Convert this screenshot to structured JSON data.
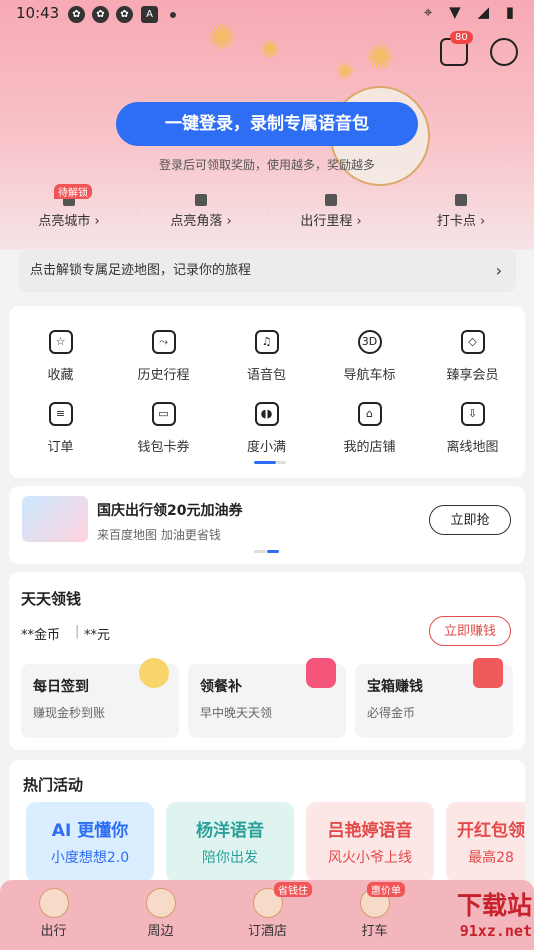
{
  "status_bar": {
    "time": "10:43",
    "left_icons": [
      "app-icon",
      "app-icon",
      "app-icon",
      "a-icon",
      "dot"
    ],
    "right_icons": [
      "location-icon",
      "wifi-icon",
      "signal-icon",
      "battery-icon"
    ]
  },
  "header": {
    "message_badge": "80",
    "icons": [
      "message-icon",
      "settings-icon"
    ]
  },
  "login": {
    "button_label": "一键登录，录制专属语音包",
    "subtitle": "登录后可领取奖励，使用越多，奖励越多"
  },
  "unlock_items": [
    {
      "label": "点亮城市 ›",
      "tag": "待解锁"
    },
    {
      "label": "点亮角落 ›",
      "tag": ""
    },
    {
      "label": "出行里程 ›",
      "tag": ""
    },
    {
      "label": "打卡点 ›",
      "tag": ""
    }
  ],
  "footprint": {
    "text": "点击解锁专属足迹地图，记录你的旅程",
    "chevron": "›"
  },
  "grid_items": [
    {
      "label": "收藏",
      "icon": "star-icon",
      "glyph": "☆"
    },
    {
      "label": "历史行程",
      "icon": "route-icon",
      "glyph": "⤳"
    },
    {
      "label": "语音包",
      "icon": "voice-icon",
      "glyph": "♫"
    },
    {
      "label": "导航车标",
      "icon": "3d-icon",
      "glyph": "3D"
    },
    {
      "label": "臻享会员",
      "icon": "diamond-icon",
      "glyph": "◇"
    },
    {
      "label": "订单",
      "icon": "order-icon",
      "glyph": "≡"
    },
    {
      "label": "钱包卡券",
      "icon": "wallet-icon",
      "glyph": "▭"
    },
    {
      "label": "度小满",
      "icon": "duxiaoman-icon",
      "glyph": "◖◗"
    },
    {
      "label": "我的店铺",
      "icon": "shop-icon",
      "glyph": "⌂"
    },
    {
      "label": "离线地图",
      "icon": "download-icon",
      "glyph": "⇩"
    }
  ],
  "promo": {
    "title": "国庆出行领20元加油券",
    "subtitle": "来百度地图 加油更省钱",
    "button": "立即抢"
  },
  "earn": {
    "title": "天天领钱",
    "coins": "**金币",
    "money": "**元",
    "button": "立即赚钱",
    "cards": [
      {
        "title": "每日签到",
        "sub": "赚现金秒到账",
        "color": "#f7d56a"
      },
      {
        "title": "领餐补",
        "sub": "早中晚天天领",
        "color": "#f4557a"
      },
      {
        "title": "宝箱赚钱",
        "sub": "必得金币",
        "color": "#f05a5a"
      }
    ]
  },
  "activities": {
    "title": "热门活动",
    "cards": [
      {
        "title": "AI 更懂你",
        "sub": "小度想想2.0",
        "bg": "#dbeeff",
        "color": "#2e6ef5"
      },
      {
        "title": "杨洋语音",
        "sub": "陪你出发",
        "bg": "#dff4f1",
        "color": "#2aa198"
      },
      {
        "title": "吕艳婷语音",
        "sub": "风火小爷上线",
        "bg": "#fde6e6",
        "color": "#e44a4a"
      },
      {
        "title": "开红包领",
        "sub": "最高28",
        "bg": "#fde6e6",
        "color": "#e44a4a"
      }
    ]
  },
  "tabbar": {
    "tabs": [
      {
        "label": "出行",
        "tag": ""
      },
      {
        "label": "周边",
        "tag": ""
      },
      {
        "label": "订酒店",
        "tag": "省钱住"
      },
      {
        "label": "打车",
        "tag": "惠价单"
      },
      {
        "label": "",
        "tag": ""
      }
    ]
  },
  "watermark": {
    "big": "下载站",
    "small": "91xz.net"
  }
}
